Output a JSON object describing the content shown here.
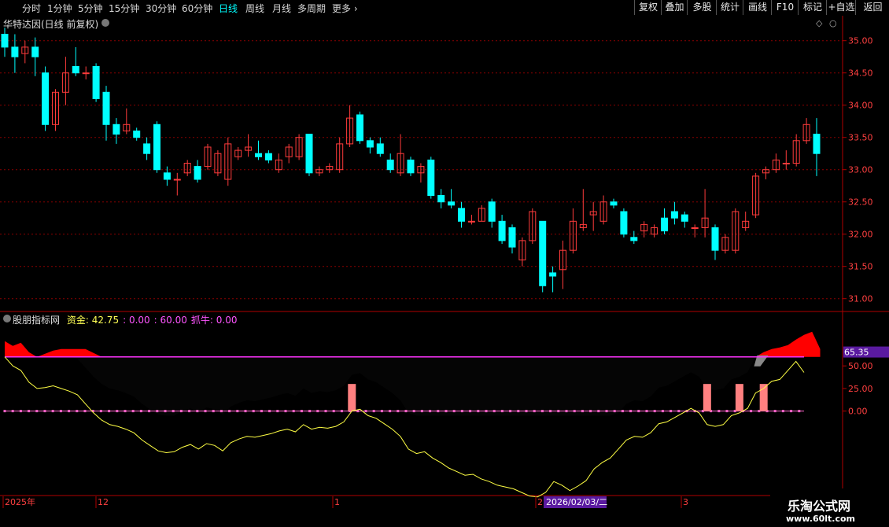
{
  "toolbar": {
    "periods": [
      "分时",
      "1分钟",
      "5分钟",
      "15分钟",
      "30分钟",
      "60分钟",
      "日线",
      "周线",
      "月线",
      "多周期",
      "更多"
    ],
    "active_period": "日线",
    "right_buttons": [
      "复权",
      "叠加",
      "多股",
      "统计",
      "画线",
      "F10",
      "标记",
      "+自选",
      "返回"
    ]
  },
  "main_panel": {
    "title": "华特达因(日线 前复权)"
  },
  "indicator_panel": {
    "name": "股朋指标网",
    "legend": [
      {
        "label": "资金",
        "value": "42.75",
        "color": "#ffff55"
      },
      {
        "label": "",
        "value": "0.00",
        "color": "#ff55ff"
      },
      {
        "label": "",
        "value": "60.00",
        "color": "#ff55ff"
      },
      {
        "label": "抓牛",
        "value": "0.00",
        "color": "#ff55ff"
      }
    ],
    "current_value": "65.35",
    "hline_value": 60,
    "zero_value": 0
  },
  "x_axis": {
    "labels": [
      "2025年",
      "12",
      "1",
      "2",
      "3"
    ],
    "cursor_label": "2026/02/03/二"
  },
  "watermark": {
    "name": "乐淘公式网",
    "url": "www.60lt.com"
  },
  "colors": {
    "up": "#ff3b3b",
    "down": "#00ffff",
    "background": "#000000",
    "grid": "#8b0000",
    "hline": "#ff33ff",
    "zero": "#ff66cc",
    "line": "#ffff44",
    "signal": "#ff8080",
    "area": "#ff0000"
  },
  "chart_data": [
    {
      "type": "candlestick",
      "y_ticks": [
        "35.00",
        "34.50",
        "34.00",
        "33.50",
        "33.00",
        "32.50",
        "32.00",
        "31.50",
        "31.00"
      ],
      "ylim": [
        30.85,
        35.35
      ],
      "candles": [
        [
          35.1,
          34.9,
          35.2,
          34.75
        ],
        [
          34.9,
          34.75,
          35.1,
          34.5
        ],
        [
          34.8,
          34.9,
          35.0,
          34.65
        ],
        [
          34.9,
          34.75,
          35.05,
          34.45
        ],
        [
          34.5,
          33.7,
          34.6,
          33.6
        ],
        [
          33.7,
          34.2,
          34.25,
          33.6
        ],
        [
          34.2,
          34.5,
          34.75,
          34.0
        ],
        [
          34.6,
          34.5,
          34.9,
          34.45
        ],
        [
          34.5,
          34.5,
          34.6,
          34.4
        ],
        [
          34.6,
          34.1,
          34.65,
          34.05
        ],
        [
          34.2,
          33.7,
          34.3,
          33.45
        ],
        [
          33.7,
          33.55,
          33.8,
          33.4
        ],
        [
          33.6,
          33.7,
          33.95,
          33.55
        ],
        [
          33.6,
          33.5,
          33.65,
          33.45
        ],
        [
          33.4,
          33.25,
          33.5,
          33.15
        ],
        [
          33.7,
          33.0,
          33.75,
          32.95
        ],
        [
          32.95,
          32.85,
          33.05,
          32.75
        ],
        [
          32.85,
          32.85,
          32.95,
          32.6
        ],
        [
          32.95,
          33.1,
          33.15,
          32.9
        ],
        [
          33.05,
          32.85,
          33.15,
          32.8
        ],
        [
          33.05,
          33.35,
          33.4,
          33.0
        ],
        [
          32.95,
          33.25,
          33.3,
          32.9
        ],
        [
          32.85,
          33.4,
          33.5,
          32.75
        ],
        [
          33.2,
          33.3,
          33.35,
          33.15
        ],
        [
          33.3,
          33.35,
          33.55,
          33.2
        ],
        [
          33.25,
          33.2,
          33.45,
          33.15
        ],
        [
          33.25,
          33.15,
          33.3,
          33.1
        ],
        [
          33.0,
          33.15,
          33.25,
          32.95
        ],
        [
          33.2,
          33.35,
          33.4,
          33.1
        ],
        [
          33.2,
          33.5,
          33.55,
          33.15
        ],
        [
          33.55,
          32.95,
          33.55,
          32.9
        ],
        [
          32.95,
          33.0,
          33.05,
          32.9
        ],
        [
          33.0,
          33.05,
          33.1,
          32.95
        ],
        [
          33.0,
          33.4,
          33.5,
          32.95
        ],
        [
          33.4,
          33.8,
          34.0,
          33.35
        ],
        [
          33.85,
          33.45,
          33.9,
          33.4
        ],
        [
          33.45,
          33.35,
          33.5,
          33.25
        ],
        [
          33.4,
          33.25,
          33.5,
          33.2
        ],
        [
          33.15,
          33.0,
          33.25,
          32.95
        ],
        [
          32.95,
          33.25,
          33.55,
          32.9
        ],
        [
          33.15,
          32.95,
          33.2,
          32.9
        ],
        [
          32.95,
          33.05,
          33.1,
          32.8
        ],
        [
          33.15,
          32.6,
          33.2,
          32.55
        ],
        [
          32.6,
          32.5,
          32.7,
          32.4
        ],
        [
          32.5,
          32.45,
          32.7,
          32.4
        ],
        [
          32.4,
          32.2,
          32.5,
          32.1
        ],
        [
          32.2,
          32.2,
          32.3,
          32.15
        ],
        [
          32.2,
          32.4,
          32.45,
          32.2
        ],
        [
          32.5,
          32.2,
          32.55,
          32.1
        ],
        [
          32.2,
          31.9,
          32.3,
          31.85
        ],
        [
          32.1,
          31.8,
          32.15,
          31.7
        ],
        [
          31.6,
          31.9,
          31.95,
          31.5
        ],
        [
          31.9,
          32.35,
          32.4,
          31.85
        ],
        [
          32.2,
          31.2,
          32.2,
          31.1
        ],
        [
          31.4,
          31.35,
          31.5,
          31.1
        ],
        [
          31.45,
          31.75,
          31.9,
          31.15
        ],
        [
          31.75,
          32.2,
          32.4,
          31.7
        ],
        [
          32.1,
          32.15,
          32.7,
          32.05
        ],
        [
          32.3,
          32.35,
          32.5,
          32.05
        ],
        [
          32.2,
          32.5,
          32.6,
          32.15
        ],
        [
          32.5,
          32.45,
          32.55,
          32.4
        ],
        [
          32.35,
          32.0,
          32.4,
          31.95
        ],
        [
          31.95,
          31.9,
          32.05,
          31.85
        ],
        [
          32.05,
          32.15,
          32.2,
          31.95
        ],
        [
          32.0,
          32.1,
          32.15,
          31.95
        ],
        [
          32.25,
          32.05,
          32.4,
          32.0
        ],
        [
          32.35,
          32.25,
          32.5,
          32.15
        ],
        [
          32.3,
          32.2,
          32.35,
          32.1
        ],
        [
          32.1,
          32.1,
          32.15,
          31.95
        ],
        [
          32.1,
          32.25,
          32.7,
          31.95
        ],
        [
          32.1,
          31.75,
          32.15,
          31.6
        ],
        [
          31.75,
          31.95,
          32.0,
          31.7
        ],
        [
          31.75,
          32.35,
          32.4,
          31.7
        ],
        [
          32.1,
          32.2,
          32.35,
          32.05
        ],
        [
          32.3,
          32.9,
          32.95,
          32.25
        ],
        [
          32.95,
          33.0,
          33.05,
          32.85
        ],
        [
          33.0,
          33.15,
          33.25,
          32.95
        ],
        [
          33.1,
          33.1,
          33.3,
          33.0
        ],
        [
          33.1,
          33.45,
          33.55,
          33.05
        ],
        [
          33.45,
          33.7,
          33.8,
          33.4
        ],
        [
          33.55,
          33.25,
          33.8,
          32.9
        ]
      ]
    },
    {
      "type": "area",
      "title": "股朋指标网",
      "y_ticks": [
        "50.00",
        "25.00",
        "0.00"
      ],
      "ylim": [
        -90,
        105
      ],
      "series": [
        {
          "name": "资金",
          "values": [
            60,
            50,
            45,
            32,
            25,
            26,
            28,
            25,
            22,
            18,
            8,
            -2,
            -10,
            -15,
            -17,
            -20,
            -24,
            -32,
            -38,
            -44,
            -46,
            -45,
            -40,
            -37,
            -42,
            -36,
            -38,
            -44,
            -35,
            -31,
            -28,
            -29,
            -27,
            -25,
            -22,
            -20,
            -23,
            -15,
            -20,
            -18,
            -19,
            -17,
            -12,
            0,
            2,
            -5,
            -8,
            -14,
            -20,
            -28,
            -42,
            -47,
            -45,
            -52,
            -57,
            -63,
            -67,
            -71,
            -70,
            -75,
            -78,
            -82,
            -84,
            -86,
            -90,
            -94,
            -95,
            -90,
            -78,
            -82,
            -88,
            -83,
            -77,
            -64,
            -57,
            -52,
            -42,
            -32,
            -28,
            -29,
            -24,
            -14,
            -12,
            -7,
            -2,
            3,
            -2,
            -15,
            -17,
            -15,
            -5,
            -2,
            3,
            20,
            25,
            33,
            35,
            45,
            55,
            42.75
          ]
        }
      ],
      "signals": [
        43,
        87,
        91,
        94
      ],
      "upper_area": [
        [
          0,
          20
        ],
        [
          1,
          14
        ],
        [
          2,
          18
        ],
        [
          3,
          6
        ],
        [
          4,
          0
        ],
        [
          5,
          4
        ],
        [
          6,
          8
        ],
        [
          7,
          10
        ],
        [
          8,
          10
        ],
        [
          9,
          10
        ],
        [
          10,
          10
        ],
        [
          11,
          5
        ],
        [
          12,
          0
        ],
        [
          93,
          0
        ],
        [
          94,
          6
        ],
        [
          95,
          10
        ],
        [
          96,
          12
        ],
        [
          97,
          15
        ],
        [
          98,
          22
        ],
        [
          99,
          28
        ],
        [
          100,
          32
        ],
        [
          101,
          10
        ]
      ]
    }
  ]
}
